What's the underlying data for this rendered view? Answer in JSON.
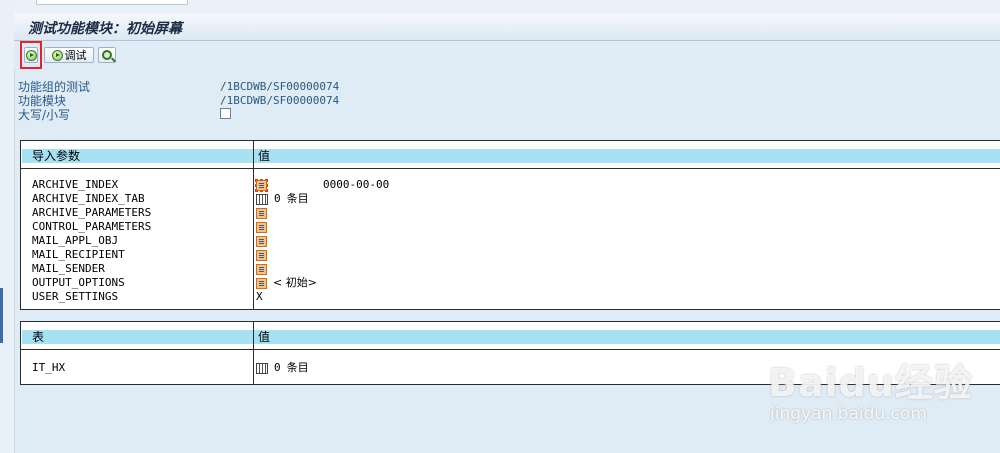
{
  "window": {
    "title": "测试功能模块：初始屏幕"
  },
  "toolbar": {
    "execute_icon": "execute-icon",
    "debug_label": "调试",
    "debug_icon": "debug-icon",
    "find_icon": "magnifier-icon"
  },
  "info": [
    {
      "label": "功能组的测试",
      "value": "/1BCDWB/SF00000074"
    },
    {
      "label": "功能模块",
      "value": "/1BCDWB/SF00000074"
    },
    {
      "label": "大写/小写",
      "checked": false
    }
  ],
  "import_params": {
    "header": {
      "name": "导入参数",
      "value": "值"
    },
    "rows": [
      {
        "name": "ARCHIVE_INDEX",
        "icon": "structure-icon",
        "value": "0000-00-00"
      },
      {
        "name": "ARCHIVE_INDEX_TAB",
        "icon": "table-icon",
        "count": "0",
        "unit": "条目"
      },
      {
        "name": "ARCHIVE_PARAMETERS",
        "icon": "structure-icon"
      },
      {
        "name": "CONTROL_PARAMETERS",
        "icon": "structure-icon"
      },
      {
        "name": "MAIL_APPL_OBJ",
        "icon": "structure-icon"
      },
      {
        "name": "MAIL_RECIPIENT",
        "icon": "structure-icon"
      },
      {
        "name": "MAIL_SENDER",
        "icon": "structure-icon"
      },
      {
        "name": "OUTPUT_OPTIONS",
        "icon": "structure-icon",
        "value": "<  初始>"
      },
      {
        "name": "USER_SETTINGS",
        "value": "X"
      }
    ]
  },
  "tables": {
    "header": {
      "name": "表",
      "value": "值"
    },
    "rows": [
      {
        "name": "IT_HX",
        "icon": "table-icon",
        "count": "0",
        "unit": "条目"
      }
    ]
  },
  "watermark": {
    "main": "Baidu经验",
    "sub": "jingyan.baidu.com"
  }
}
